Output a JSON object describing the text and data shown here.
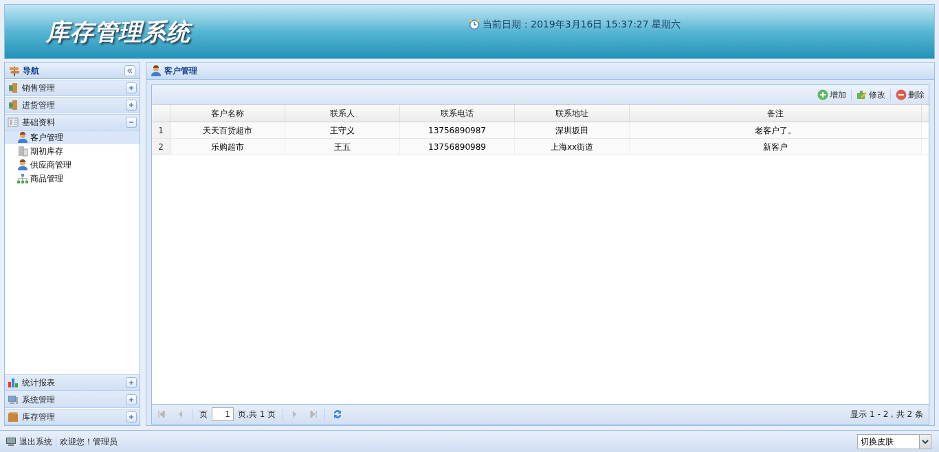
{
  "header": {
    "title": "库存管理系统",
    "date_text": "当前日期：2019年3月16日 15:37:27 星期六"
  },
  "nav": {
    "title": "导航",
    "sections": [
      {
        "label": "销售管理",
        "expanded": false
      },
      {
        "label": "进货管理",
        "expanded": false
      },
      {
        "label": "基础资料",
        "expanded": true,
        "children": [
          {
            "label": "客户管理",
            "selected": true
          },
          {
            "label": "期初库存",
            "selected": false
          },
          {
            "label": "供应商管理",
            "selected": false
          },
          {
            "label": "商品管理",
            "selected": false
          }
        ]
      },
      {
        "label": "统计报表",
        "expanded": false
      },
      {
        "label": "系统管理",
        "expanded": false
      },
      {
        "label": "库存管理",
        "expanded": false
      }
    ]
  },
  "main": {
    "title": "客户管理",
    "toolbar": [
      {
        "label": "增加",
        "kind": "add"
      },
      {
        "label": "修改",
        "kind": "edit"
      },
      {
        "label": "删除",
        "kind": "delete"
      }
    ],
    "table": {
      "columns": [
        "客户名称",
        "联系人",
        "联系电话",
        "联系地址",
        "备注"
      ],
      "rows": [
        {
          "number": "1",
          "cells": [
            "天天百货超市",
            "王守义",
            "13756890987",
            "深圳坂田",
            "老客户了。"
          ]
        },
        {
          "number": "2",
          "cells": [
            "乐购超市",
            "王五",
            "13756890989",
            "上海xx街道",
            "新客户"
          ]
        }
      ]
    },
    "pager": {
      "page_label": "页",
      "page_value": "1",
      "page_total": "页,共 1 页",
      "summary": "显示 1 - 2 , 共 2 条"
    }
  },
  "footer": {
    "logout": "退出系统",
    "welcome": "欢迎您！管理员",
    "skin_select": "切换皮肤"
  }
}
